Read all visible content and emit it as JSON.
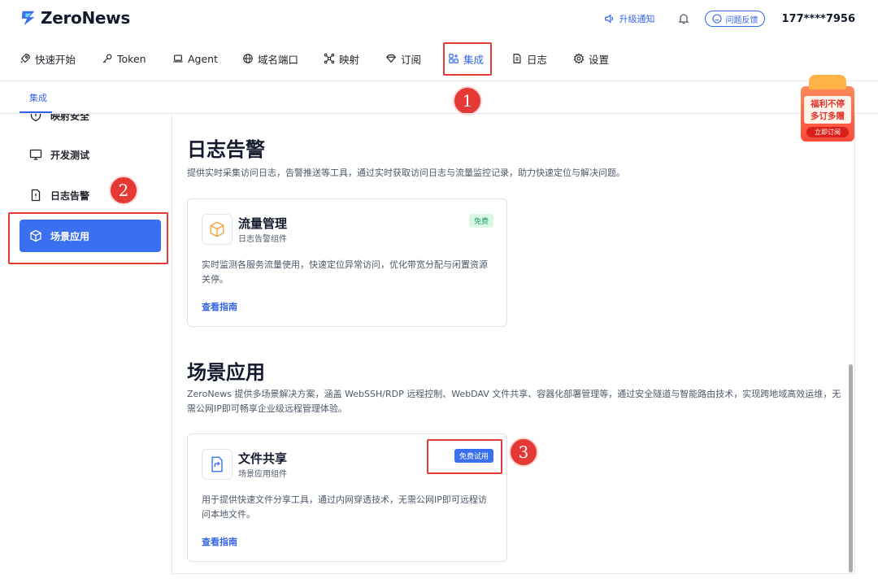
{
  "app": {
    "name": "ZeroNews",
    "brand_color": "#3665e8"
  },
  "header": {
    "upgrade_label": "升级通知",
    "feedback_label": "问题反馈",
    "user_phone": "177****7956"
  },
  "nav": {
    "items": [
      {
        "label": "快速开始",
        "icon": "rocket-icon"
      },
      {
        "label": "Token",
        "icon": "key-icon"
      },
      {
        "label": "Agent",
        "icon": "laptop-icon"
      },
      {
        "label": "域名端口",
        "icon": "globe-icon"
      },
      {
        "label": "映射",
        "icon": "mapping-icon"
      },
      {
        "label": "订阅",
        "icon": "diamond-icon"
      },
      {
        "label": "集成",
        "icon": "integration-icon",
        "active": true
      },
      {
        "label": "日志",
        "icon": "document-icon"
      },
      {
        "label": "设置",
        "icon": "gear-icon"
      }
    ]
  },
  "subtab": {
    "label": "集成"
  },
  "sidebar": {
    "items": [
      {
        "label": "映射安全",
        "icon": "shield-icon"
      },
      {
        "label": "开发测试",
        "icon": "monitor-icon"
      },
      {
        "label": "日志告警",
        "icon": "alert-doc-icon"
      },
      {
        "label": "场景应用",
        "icon": "cube-icon",
        "active": true
      }
    ]
  },
  "sections": [
    {
      "title": "日志告警",
      "description": "提供实时采集访问日志，告警推送等工具，通过实时获取访问日志与流量监控记录，助力快速定位与解决问题。",
      "card": {
        "title": "流量管理",
        "subtitle": "日志告警组件",
        "badge": "免费",
        "description": "实时监测各服务流量使用，快速定位异常访问，优化带宽分配与闲置资源关停。",
        "link": "查看指南",
        "icon": "package-icon"
      }
    },
    {
      "title": "场景应用",
      "description": "ZeroNews 提供多场景解决方案，涵盖 WebSSH/RDP 远程控制、WebDAV 文件共享、容器化部署管理等，通过安全隧道与智能路由技术，实现跨地域高效运维，无需公网IP即可畅享企业级远程管理体验。",
      "card": {
        "title": "文件共享",
        "subtitle": "场景应用组件",
        "badge": "免费试用",
        "description": "用于提供快速文件分享工具，通过内网穿透技术，无需公网IP即可远程访问本地文件。",
        "link": "查看指南",
        "icon": "file-share-icon"
      }
    }
  ],
  "promo": {
    "line1": "福利不停",
    "line2": "多订多赠",
    "button": "立即订阅"
  },
  "annotations": [
    "1",
    "2",
    "3"
  ]
}
